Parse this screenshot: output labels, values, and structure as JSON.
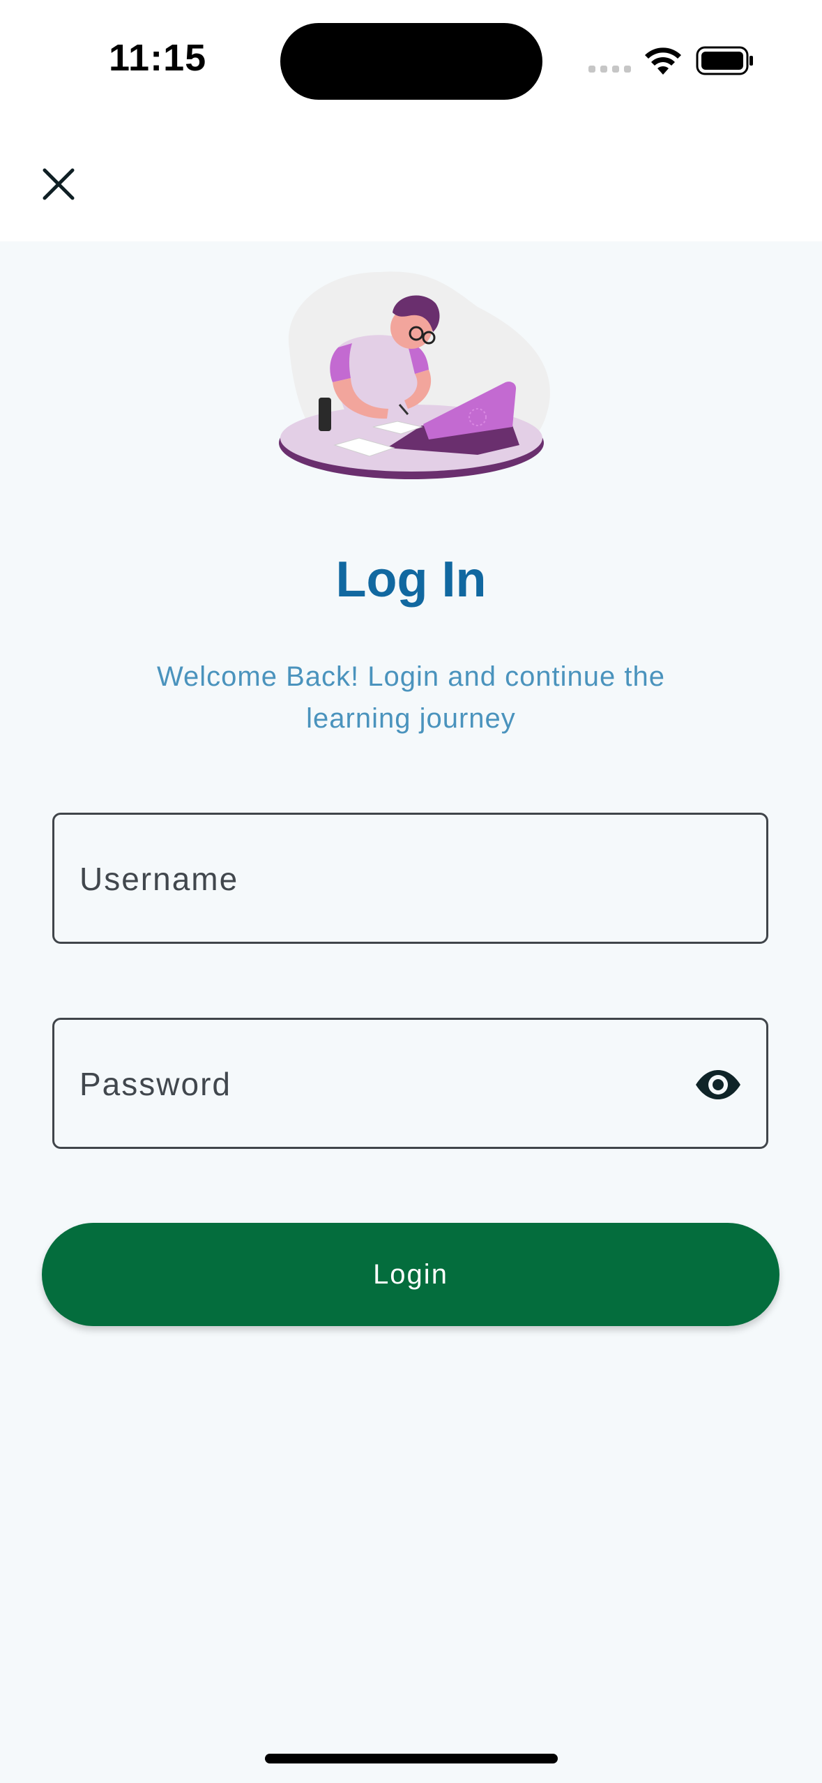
{
  "status_bar": {
    "time": "11:15",
    "icons": [
      "signal-icon",
      "wifi-icon",
      "battery-icon"
    ]
  },
  "top_bar": {
    "close_icon": "close-icon"
  },
  "hero": {
    "illustration": "person-studying-with-laptop-illustration"
  },
  "title": "Log In",
  "subtitle": "Welcome Back! Login and continue the learning journey",
  "form": {
    "username": {
      "placeholder": "Username",
      "value": ""
    },
    "password": {
      "placeholder": "Password",
      "value": "",
      "toggle_icon": "eye-icon"
    }
  },
  "login_button": {
    "label": "Login"
  },
  "colors": {
    "title": "#1168a0",
    "subtitle": "#4a93bd",
    "primary_button": "#046d3d",
    "background": "#f5f9fb",
    "illustration_accent": "#c36ad1"
  }
}
